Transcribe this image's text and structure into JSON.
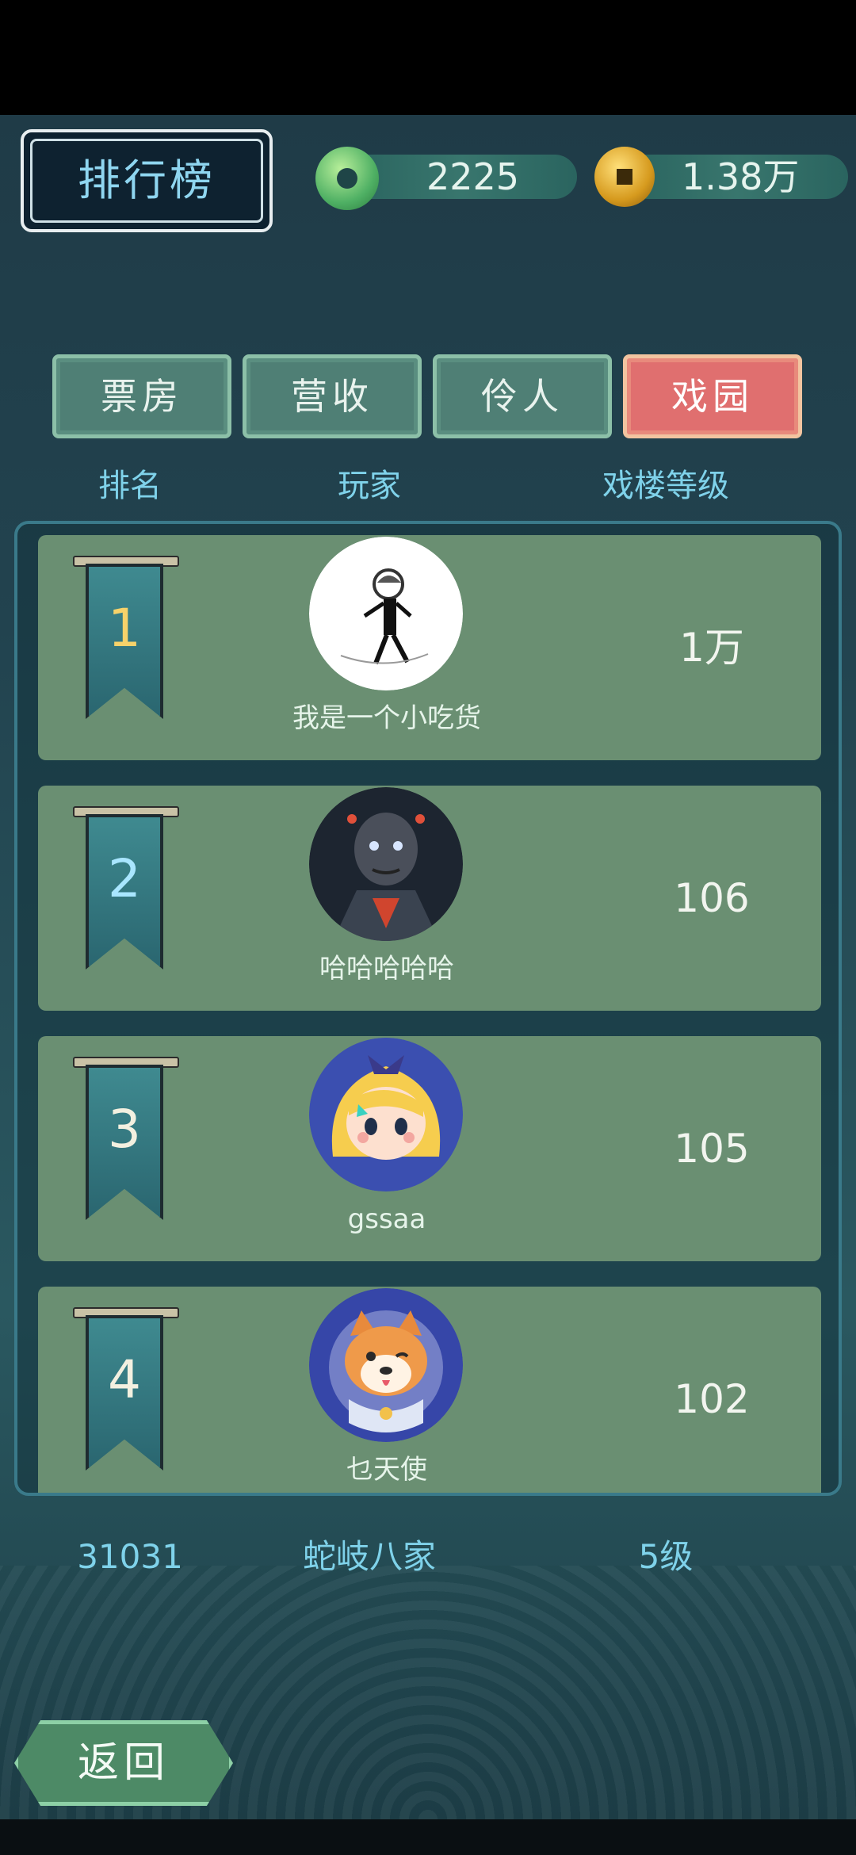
{
  "title": "排行榜",
  "currency": {
    "jade_value": "2225",
    "coin_value": "1.38万"
  },
  "tabs": [
    {
      "label": "票房",
      "active": false
    },
    {
      "label": "营收",
      "active": false
    },
    {
      "label": "伶人",
      "active": false
    },
    {
      "label": "戏园",
      "active": true
    }
  ],
  "columns": {
    "rank": "排名",
    "player": "玩家",
    "level": "戏楼等级"
  },
  "rows": [
    {
      "rank": "1",
      "name": "我是一个小吃货",
      "level": "1万",
      "avatar_icon": "sketch-figure-avatar"
    },
    {
      "rank": "2",
      "name": "哈哈哈哈哈",
      "level": "106",
      "avatar_icon": "armored-warrior-avatar"
    },
    {
      "rank": "3",
      "name": "gssaa",
      "level": "105",
      "avatar_icon": "blonde-girl-avatar"
    },
    {
      "rank": "4",
      "name": "乜天使",
      "level": "102",
      "avatar_icon": "shiba-dog-avatar"
    }
  ],
  "self": {
    "rank": "31031",
    "name": "蛇岐八家",
    "level": "5级"
  },
  "back_label": "返回",
  "colors": {
    "accent_text": "#7fd2ea",
    "row_bg": "#6a8f72",
    "active_tab": "#e06f6f",
    "tab_bg": "#4f7f75"
  }
}
